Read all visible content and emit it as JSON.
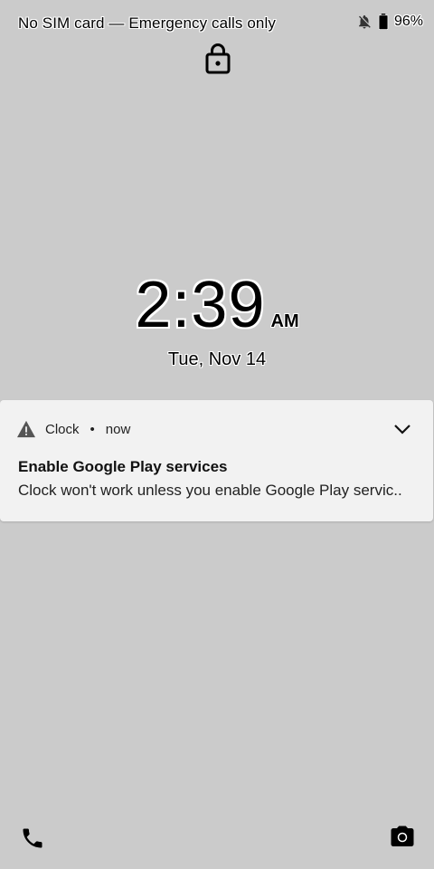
{
  "status_bar": {
    "carrier_text": "No SIM card — Emergency calls only",
    "battery_percent": "96%",
    "icons": [
      "notifications-off-icon",
      "battery-icon"
    ]
  },
  "lockscreen": {
    "lock_icon": "lock-icon",
    "time": "2:39",
    "ampm": "AM",
    "date": "Tue, Nov 14"
  },
  "notification": {
    "icon": "warning-icon",
    "app_name": "Clock",
    "separator": "•",
    "when": "now",
    "title": "Enable Google Play services",
    "body": "Clock won't work unless you enable Google Play servic..",
    "expand_icon": "chevron-down-icon"
  },
  "shortcuts": {
    "left": "phone-icon",
    "right": "camera-icon"
  }
}
